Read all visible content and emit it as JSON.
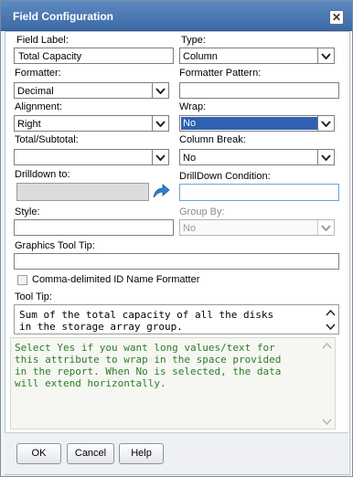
{
  "dialog": {
    "title": "Field Configuration"
  },
  "fields": {
    "field_label": {
      "label": "Field Label:",
      "value": "Total Capacity"
    },
    "type": {
      "label": "Type:",
      "value": "Column"
    },
    "formatter": {
      "label": "Formatter:",
      "value": "Decimal"
    },
    "formatter_pattern": {
      "label": "Formatter Pattern:",
      "value": ""
    },
    "alignment": {
      "label": "Alignment:",
      "value": "Right"
    },
    "wrap": {
      "label": "Wrap:",
      "value": "No"
    },
    "total_subtotal": {
      "label": "Total/Subtotal:",
      "value": ""
    },
    "column_break": {
      "label": "Column Break:",
      "value": "No"
    },
    "drilldown_to": {
      "label": "Drilldown to:",
      "value": ""
    },
    "drilldown_condition": {
      "label": "DrillDown Condition:",
      "value": ""
    },
    "style": {
      "label": "Style:",
      "value": ""
    },
    "group_by": {
      "label": "Group By:",
      "value": "No"
    },
    "graphics_tool_tip": {
      "label": "Graphics Tool Tip:",
      "value": ""
    },
    "comma_delimited": {
      "label": "Comma-delimited ID Name Formatter",
      "checked": false
    },
    "tool_tip": {
      "label": "Tool Tip:",
      "value": "Sum of the total capacity of all the disks\nin the storage array group."
    }
  },
  "help_text": "Select Yes if you want long values/text for\nthis attribute to wrap in the space provided\nin the report. When No is selected, the data\nwill extend horizontally.",
  "buttons": {
    "ok": "OK",
    "cancel": "Cancel",
    "help": "Help"
  },
  "colors": {
    "title_bar": "#4a78b4",
    "help_text": "#2a7d2a",
    "selection": "#3060b0"
  }
}
